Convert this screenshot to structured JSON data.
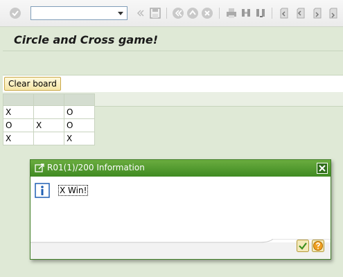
{
  "toolbar": {
    "command_field_value": "",
    "icons": [
      "enter-icon",
      "back-arrows-icon",
      "save-icon",
      "back-icon",
      "exit-icon",
      "cancel-icon",
      "print-icon",
      "find-icon",
      "find-next-icon",
      "first-page-icon",
      "previous-page-icon",
      "next-page-icon",
      "last-page-icon"
    ]
  },
  "header": {
    "title": "Circle and Cross game!"
  },
  "actions": {
    "clear_board_label": "Clear board"
  },
  "board": {
    "rows": [
      [
        "X",
        "",
        "O"
      ],
      [
        "O",
        "X",
        "O"
      ],
      [
        "X",
        "",
        "X"
      ]
    ]
  },
  "dialog": {
    "title": "R01(1)/200 Information",
    "message": "X Win!",
    "icons": [
      "dialog-window-icon",
      "close-icon",
      "info-icon",
      "confirm-check-icon",
      "help-icon"
    ]
  },
  "colors": {
    "background": "#dfe9d6",
    "dialog_title": "#4f9a2f",
    "button_yellow": "#f6e6a6"
  }
}
